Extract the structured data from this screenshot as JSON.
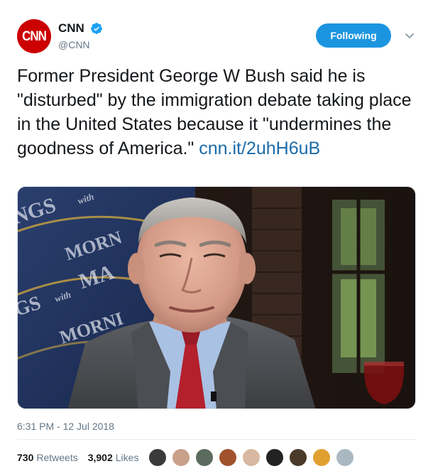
{
  "account": {
    "avatar_text": "CNN",
    "display_name": "CNN",
    "handle": "@CNN",
    "verified": true
  },
  "follow_button": {
    "label": "Following"
  },
  "tweet": {
    "text": "Former President George W Bush said he is \"disturbed\" by the immigration debate taking place in the United States because it \"undermines the goodness of America.\"",
    "link_text": "cnn.it/2uhH6uB"
  },
  "media": {
    "backdrop_text_top": "NGS",
    "backdrop_text_mid": "MORN",
    "backdrop_text_with": "with",
    "backdrop_text_ma": "MA",
    "backdrop_text_low": "GS",
    "backdrop_text_morni": "MORNI"
  },
  "meta": {
    "timestamp": "6:31 PM - 12 Jul 2018"
  },
  "stats": {
    "retweets_count": "730",
    "retweets_label": "Retweets",
    "likes_count": "3,902",
    "likes_label": "Likes"
  },
  "likers": [
    {
      "name": "liker-avatar-1",
      "color": "#3a3a3a"
    },
    {
      "name": "liker-avatar-2",
      "color": "#c9a08a"
    },
    {
      "name": "liker-avatar-3",
      "color": "#5b6b5e"
    },
    {
      "name": "liker-avatar-4",
      "color": "#a0522d"
    },
    {
      "name": "liker-avatar-5",
      "color": "#d8b8a0"
    },
    {
      "name": "liker-avatar-6",
      "color": "#222222"
    },
    {
      "name": "liker-avatar-7",
      "color": "#4a3a2a"
    },
    {
      "name": "liker-avatar-8",
      "color": "#e0a030"
    },
    {
      "name": "liker-avatar-9",
      "color": "#aab8c2"
    }
  ],
  "colors": {
    "accent": "#1b95e0",
    "link": "#1b6ba8",
    "brand_red": "#cc0000",
    "muted": "#657786"
  }
}
